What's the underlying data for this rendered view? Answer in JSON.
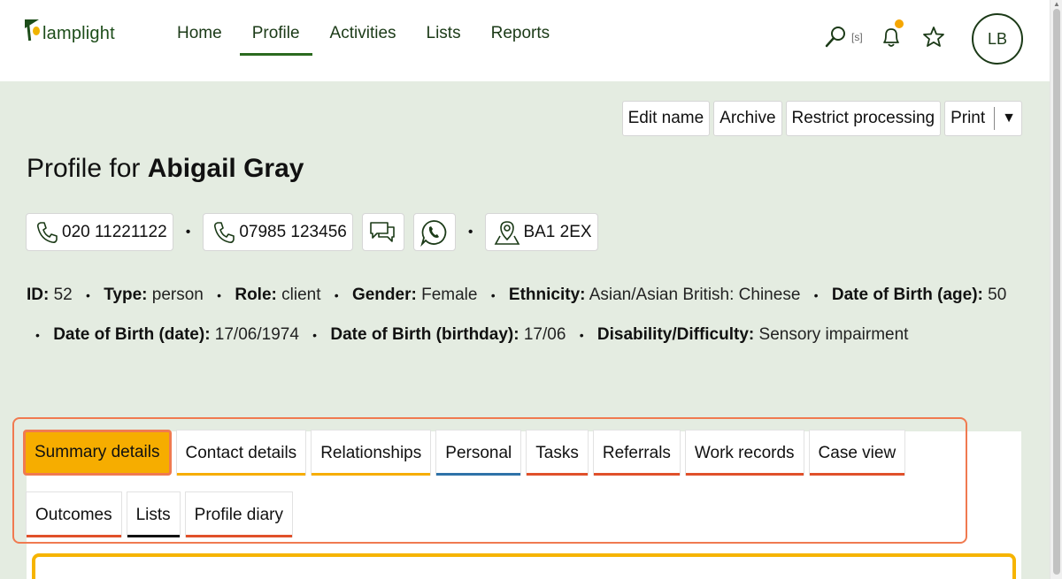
{
  "brand": {
    "name": "lamplight"
  },
  "nav": {
    "items": [
      {
        "label": "Home",
        "active": false
      },
      {
        "label": "Profile",
        "active": true
      },
      {
        "label": "Activities",
        "active": false
      },
      {
        "label": "Lists",
        "active": false
      },
      {
        "label": "Reports",
        "active": false
      }
    ]
  },
  "tools": {
    "search_shortcut": "[s]",
    "avatar_initials": "LB",
    "notification_color": "#f5a600"
  },
  "actions": {
    "edit_name": "Edit name",
    "archive": "Archive",
    "restrict": "Restrict processing",
    "print": "Print",
    "print_caret": "▼"
  },
  "profile": {
    "title_prefix": "Profile for",
    "name": "Abigail Gray",
    "phone1": "020 11221122",
    "phone2": "07985 123456",
    "postcode": "BA1 2EX",
    "separator": "•"
  },
  "details": {
    "id_label": "ID:",
    "id": "52",
    "type_label": "Type:",
    "type": "person",
    "role_label": "Role:",
    "role": "client",
    "gender_label": "Gender:",
    "gender": "Female",
    "ethnicity_label": "Ethnicity:",
    "ethnicity": "Asian/Asian British: Chinese",
    "dob_age_label": "Date of Birth (age):",
    "dob_age": "50",
    "dob_date_label": "Date of Birth (date):",
    "dob_date": "17/06/1974",
    "dob_birthday_label": "Date of Birth (birthday):",
    "dob_birthday": "17/06",
    "disability_label": "Disability/Difficulty:",
    "disability": "Sensory impairment"
  },
  "tabs": {
    "row1": [
      {
        "label": "Summary details",
        "accent": "#f6ad00"
      },
      {
        "label": "Contact details",
        "accent": "#f6ad00"
      },
      {
        "label": "Relationships",
        "accent": "#f6ad00"
      },
      {
        "label": "Personal",
        "accent": "#2e72a8"
      },
      {
        "label": "Tasks",
        "accent": "#e0502a"
      },
      {
        "label": "Referrals",
        "accent": "#e0502a"
      },
      {
        "label": "Work records",
        "accent": "#e0502a"
      },
      {
        "label": "Case view",
        "accent": "#e0502a"
      }
    ],
    "row2": [
      {
        "label": "Outcomes",
        "accent": "#e0502a"
      },
      {
        "label": "Lists",
        "accent": "#111111"
      },
      {
        "label": "Profile diary",
        "accent": "#e0502a"
      }
    ]
  }
}
